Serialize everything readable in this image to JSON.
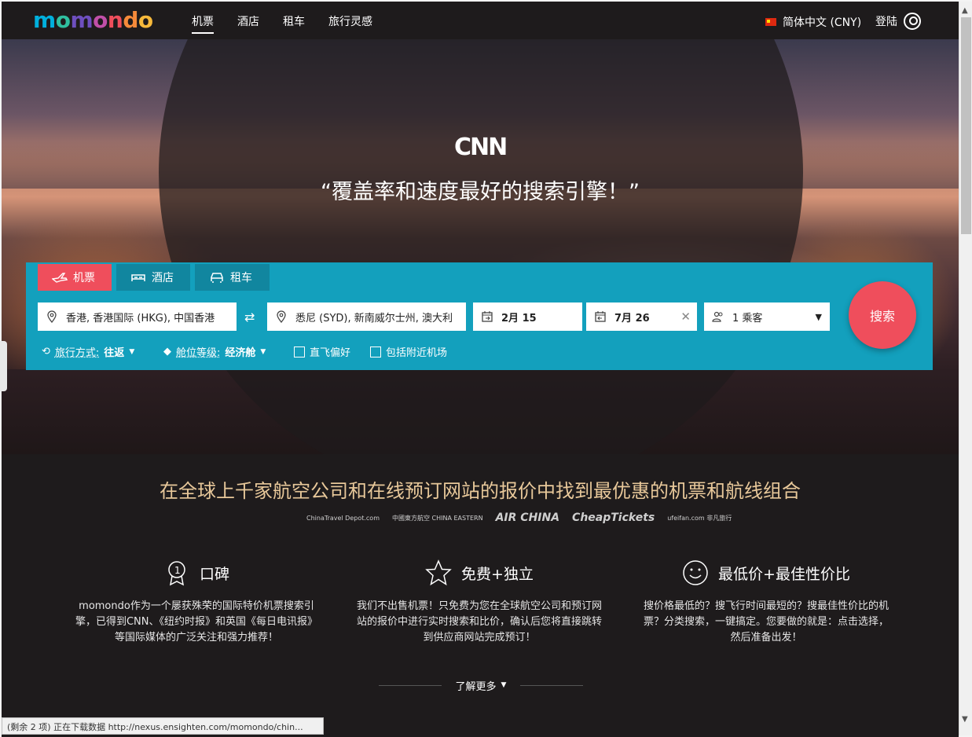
{
  "nav": {
    "logo": "momondo",
    "links": [
      "机票",
      "酒店",
      "租车",
      "旅行灵感"
    ],
    "language": "简体中文 (CNY)",
    "login": "登陆"
  },
  "hero": {
    "cnn_logo": "CNN",
    "quote": "“覆盖率和速度最好的搜索引擎！”"
  },
  "search": {
    "tabs": [
      "机票",
      "酒店",
      "租车"
    ],
    "origin": "香港, 香港国际 (HKG), 中国香港",
    "destination": "悉尼 (SYD), 新南威尔士州, 澳大利",
    "depart_date": "2月 15",
    "return_date": "7月 26",
    "passengers": "1 乘客",
    "button": "搜索",
    "trip_type_label": "旅行方式:",
    "trip_type_value": "往返",
    "cabin_label": "舱位等级:",
    "cabin_value": "经济舱",
    "direct_label": "直飞偏好",
    "nearby_label": "包括附近机场"
  },
  "tagline": "在全球上千家航空公司和在线预订网站的报价中找到最优惠的机票和航线组合",
  "partners": [
    "ChinaTravel Depot.com",
    "中國東方航空 CHINA EASTERN",
    "AIR CHINA",
    "CheapTickets",
    "ufeifan.com 非凡旅行"
  ],
  "features": [
    {
      "icon": "award-ribbon-icon",
      "title": "口碑",
      "body": "momondo作为一个屡获殊荣的国际特价机票搜索引擎，已得到CNN、《纽约时报》和英国《每日电讯报》等国际媒体的广泛关注和强力推荐！"
    },
    {
      "icon": "star-icon",
      "title": "免费+独立",
      "body": "我们不出售机票！只免费为您在全球航空公司和预订网站的报价中进行实时搜索和比价，确认后您将直接跳转到供应商网站完成预订！"
    },
    {
      "icon": "smiley-icon",
      "title": "最低价+最佳性价比",
      "body": "搜价格最低的？搜飞行时间最短的？搜最佳性价比的机票？分类搜索，一键搞定。您要做的就是：点击选择，然后准备出发！"
    }
  ],
  "learn_more": "了解更多",
  "status_bar": "(剩余 2 项) 正在下载数据 http://nexus.ensighten.com/momondo/chin...",
  "colors": {
    "accent_red": "#ef4e5c",
    "panel_teal": "#13a0bd",
    "tagline_gold": "#e8c89a",
    "bg_dark": "#1e1b1c"
  }
}
